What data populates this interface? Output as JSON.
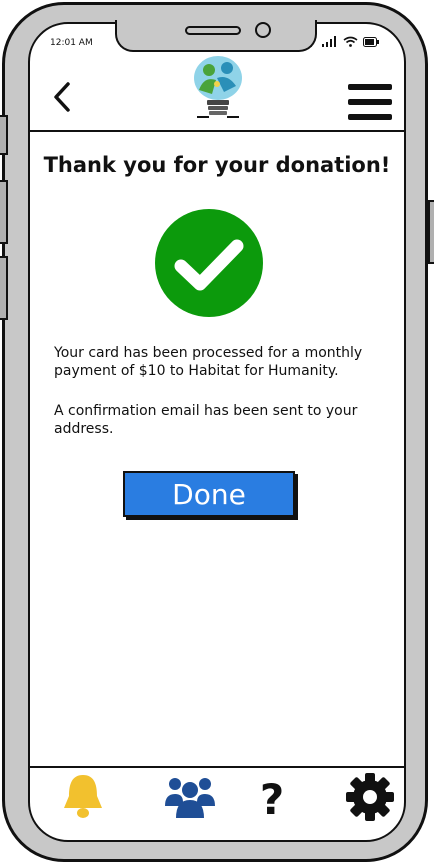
{
  "status_bar": {
    "time": "12:01 AM"
  },
  "header": {
    "back_icon": "chevron-left-icon",
    "logo_icon": "lightbulb-people-logo",
    "menu_icon": "hamburger-menu-icon"
  },
  "main": {
    "title": "Thank you for your donation!",
    "success_icon": "checkmark-circle-icon",
    "message_1": "Your card has been processed for a monthly payment of $10 to Habitat for Humanity.",
    "message_2": "A confirmation email has been sent to your address.",
    "done_label": "Done"
  },
  "tabbar": {
    "items": [
      {
        "icon": "bell-icon",
        "color": "#f2c12e"
      },
      {
        "icon": "group-icon",
        "color": "#1f4e96"
      },
      {
        "icon": "question-icon",
        "color": "#111111"
      },
      {
        "icon": "gear-icon",
        "color": "#111111"
      }
    ]
  },
  "colors": {
    "accent": "#2a7de1",
    "success": "#0c9a0c"
  }
}
